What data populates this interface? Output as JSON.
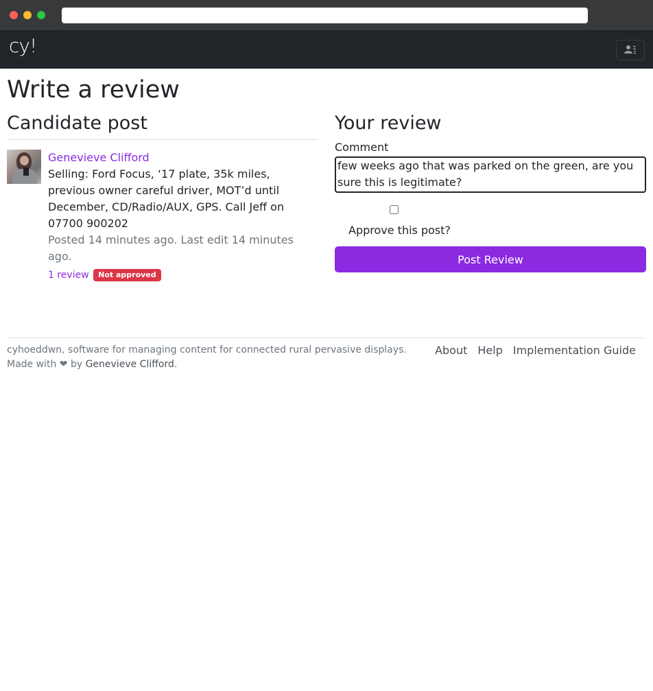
{
  "navbar": {
    "brand": "cy!",
    "user_menu_icon": "person-lines-icon"
  },
  "page": {
    "title": "Write a review"
  },
  "candidate": {
    "heading": "Candidate post",
    "author": "Genevieve Clifford",
    "text": "Selling: Ford Focus, ‘17 plate, 35k miles, previous owner careful driver, MOT’d until December, CD/Radio/AUX, GPS. Call Jeff on 07700 900202",
    "meta": "Posted 14 minutes ago. Last edit 14 minutes ago.",
    "review_count": "1 review",
    "status_badge": "Not approved"
  },
  "review": {
    "heading": "Your review",
    "comment_label": "Comment",
    "comment_visible_value": "few weeks ago that was parked on the green, are you sure this is legitimate?",
    "approve_checked": false,
    "approve_label": "Approve this post?",
    "submit_label": "Post Review"
  },
  "footer": {
    "tagline": "cyhoeddwn, software for managing content for connected rural pervasive displays.",
    "made_with_prefix": "Made with",
    "heart": "❤",
    "made_with_by": "by",
    "author": "Genevieve Clifford",
    "links": [
      "About",
      "Help",
      "Implementation Guide"
    ]
  },
  "colors": {
    "accent": "#8a2be2",
    "danger": "#dc3545",
    "navbar": "#212529"
  }
}
